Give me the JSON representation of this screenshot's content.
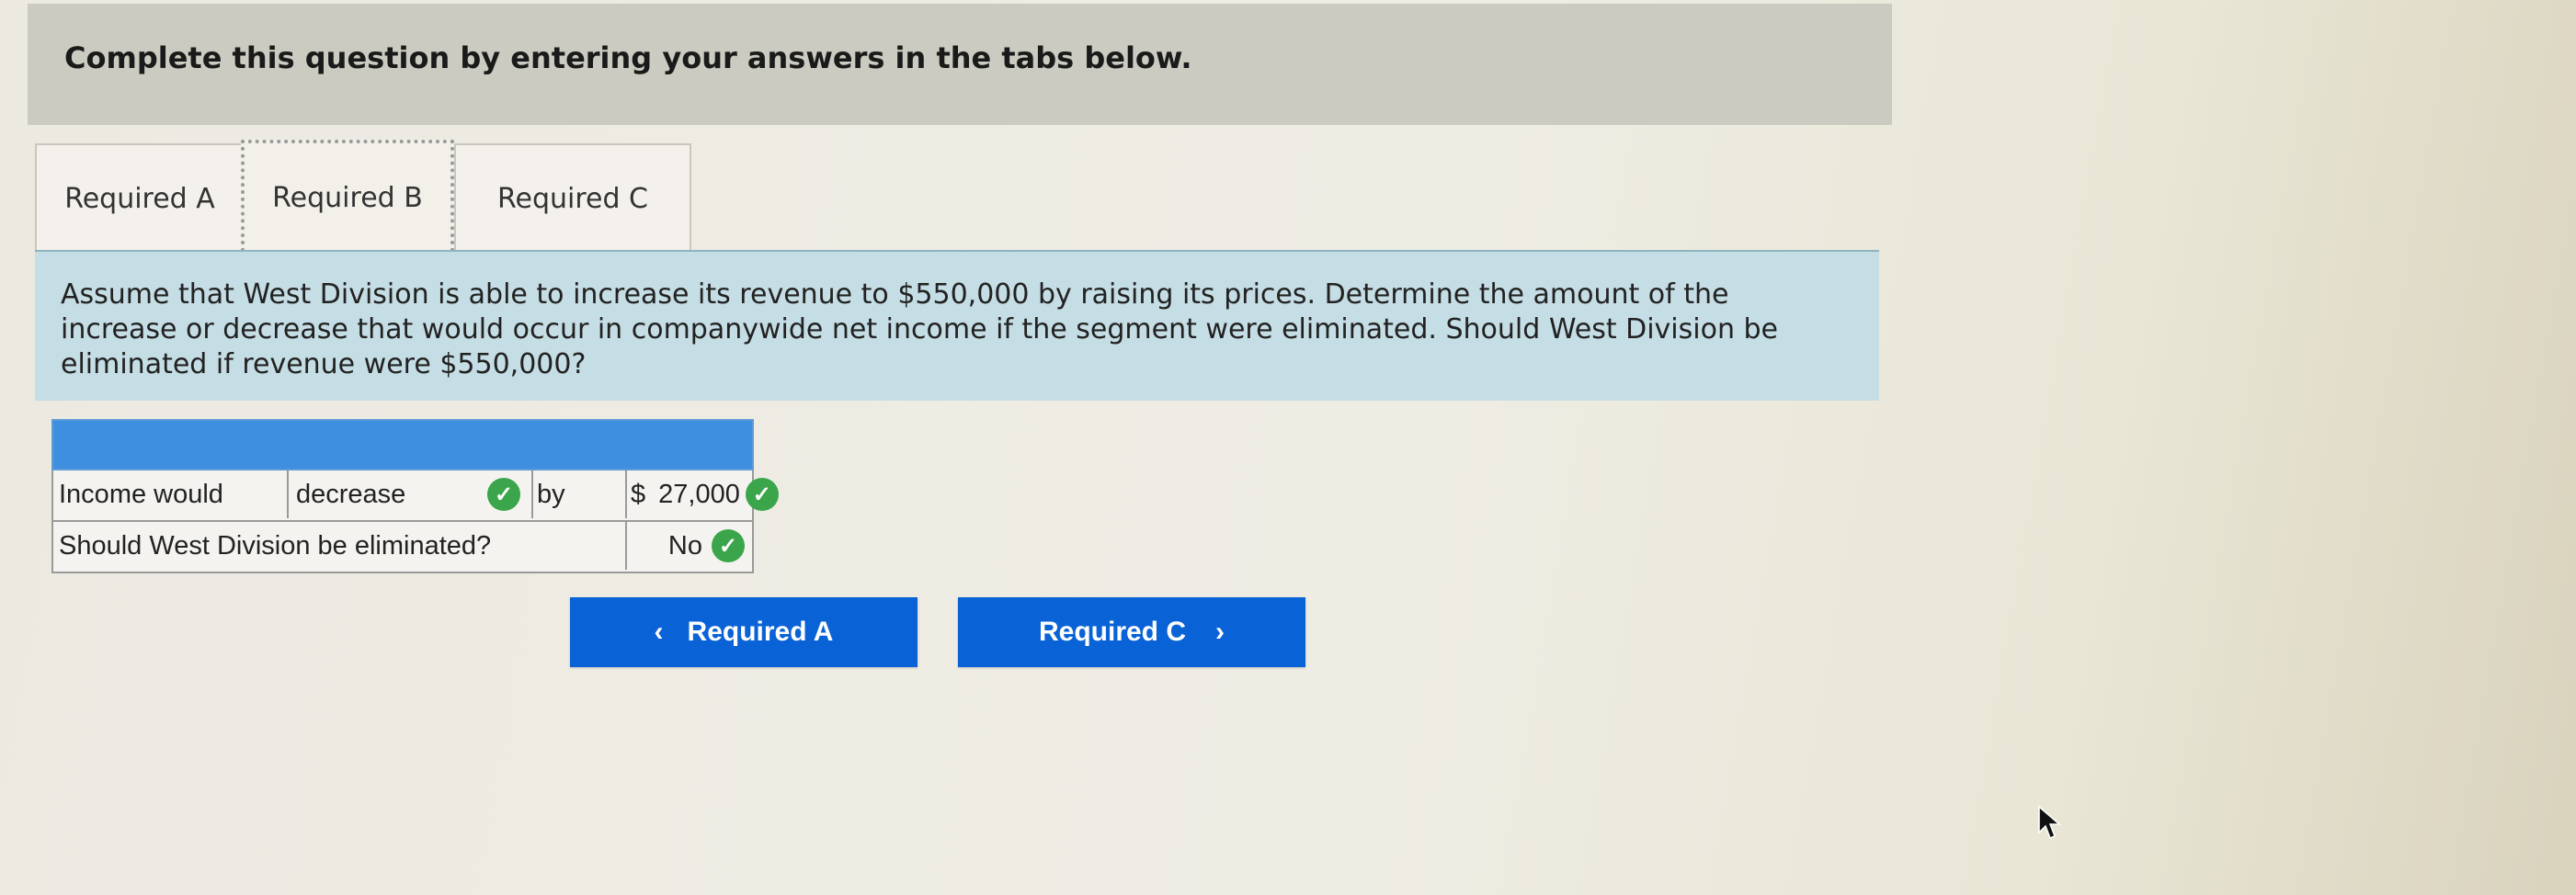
{
  "header": {
    "instruction": "Complete this question by entering your answers in the tabs below."
  },
  "tabs": [
    {
      "label": "Required A",
      "active": false
    },
    {
      "label": "Required B",
      "active": true
    },
    {
      "label": "Required C",
      "active": false
    }
  ],
  "question": {
    "text": "Assume that West Division is able to increase its revenue to $550,000 by raising its prices. Determine the amount of the increase or decrease that would occur in companywide net income if the segment were eliminated. Should West Division be eliminated if revenue were $550,000?"
  },
  "answer_table": {
    "row1": {
      "label": "Income would",
      "dropdown_value": "decrease",
      "connector": "by",
      "currency": "$",
      "amount": "27,000"
    },
    "row2": {
      "question": "Should West Division be eliminated?",
      "answer": "No"
    },
    "status_icon": "check-circle-icon",
    "header_color": "#3f8fe0"
  },
  "navigation": {
    "prev_label": "Required A",
    "next_label": "Required C",
    "prev_icon": "chevron-left-icon",
    "next_icon": "chevron-right-icon",
    "button_color": "#0a63d6"
  },
  "colors": {
    "check_green": "#3aa54a",
    "question_bg": "#c5dde4"
  }
}
